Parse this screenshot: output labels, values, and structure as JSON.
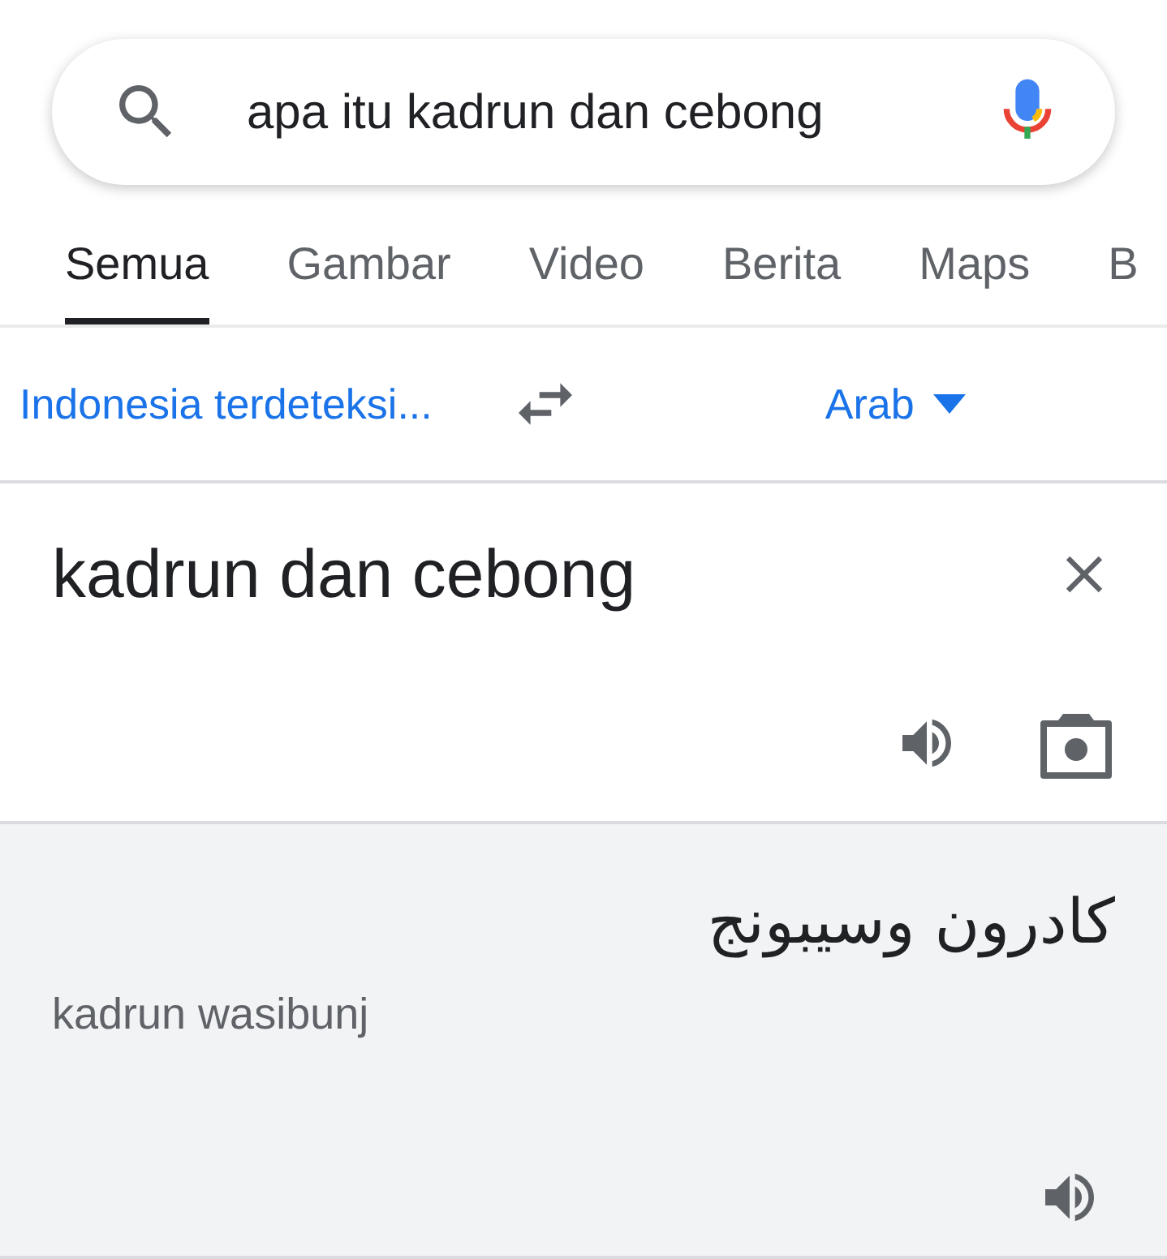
{
  "search": {
    "value": "apa itu kadrun dan cebong"
  },
  "tabs": [
    {
      "label": "Semua",
      "selected": true
    },
    {
      "label": "Gambar",
      "selected": false
    },
    {
      "label": "Video",
      "selected": false
    },
    {
      "label": "Berita",
      "selected": false
    },
    {
      "label": "Maps",
      "selected": false
    },
    {
      "label": "B",
      "selected": false
    }
  ],
  "translate": {
    "source_language": "Indonesia terdeteksi...",
    "target_language": "Arab",
    "input": "kadrun dan cebong",
    "output": "كادرون وسيبونج",
    "transliteration": "kadrun wasibunj"
  }
}
